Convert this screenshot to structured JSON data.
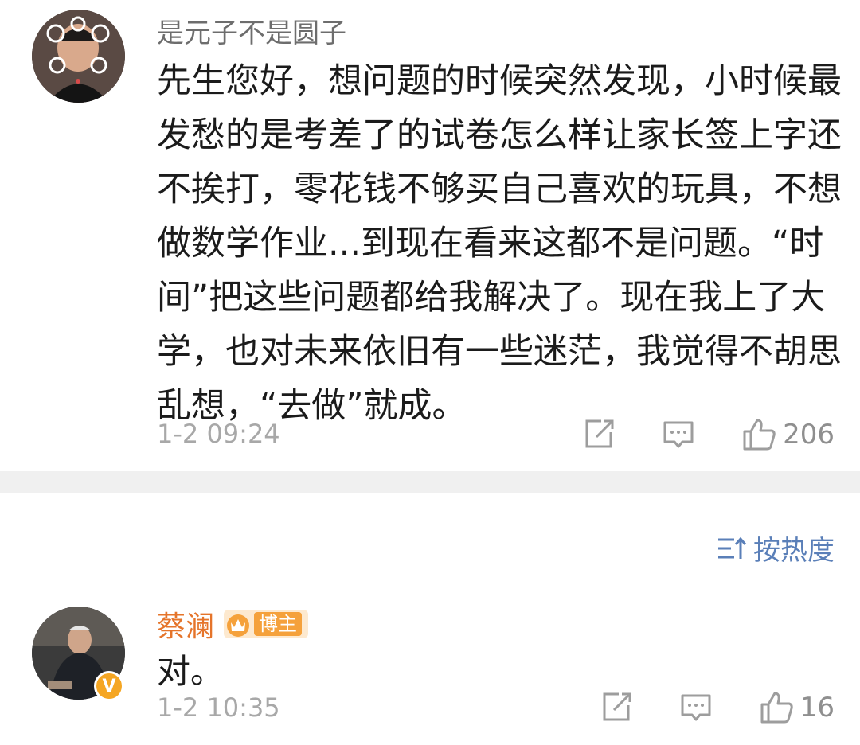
{
  "comments": [
    {
      "username": "是元子不是圆子",
      "content_lines": [
        "先生您好，想问题的时候突然发现，小时候最",
        "发愁的是考差了的试卷怎么样让家长签上字还",
        "不挨打，零花钱不够买自己喜欢的玩具，不想",
        "做数学作业...到现在看来这都不是问题。“时",
        "间”把这些问题都给我解决了。现在我上了大",
        "学，也对未来依旧有一些迷茫，我觉得不胡思",
        "乱想，“去做”就成。"
      ],
      "timestamp": "1-2 09:24",
      "like_count": "206",
      "icons": [
        "share-icon",
        "comment-icon",
        "like-icon"
      ]
    }
  ],
  "sort": {
    "label": "按热度",
    "icon": "sort-icon"
  },
  "replies": [
    {
      "username": "蔡澜",
      "badge": "博主",
      "verified_mark": "V",
      "content": "对。",
      "timestamp": "1-2 10:35",
      "like_count": "16",
      "icons": [
        "share-icon",
        "comment-icon",
        "like-icon"
      ]
    }
  ],
  "colors": {
    "accent_name": "#e5742a",
    "sort_blue": "#5a7fb8",
    "divider": "#f0f0f0"
  }
}
